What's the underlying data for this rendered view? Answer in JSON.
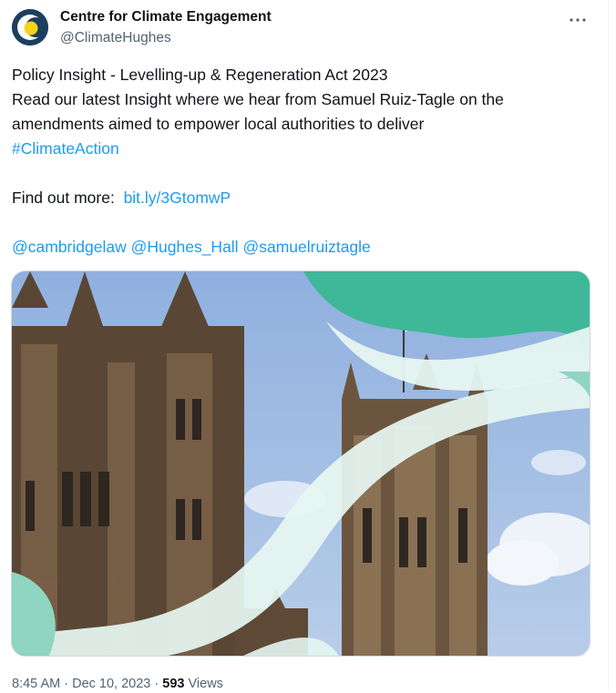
{
  "author": {
    "display_name": "Centre for Climate Engagement",
    "handle": "@ClimateHughes"
  },
  "tweet": {
    "line1": "Policy Insight - Levelling-up & Regeneration Act 2023",
    "line2": "Read our latest Insight where we hear from Samuel Ruiz-Tagle on the",
    "line3": "amendments aimed to empower local authorities to deliver",
    "hashtag": "#ClimateAction",
    "find_out_label": "Find out more:",
    "find_out_link": "bit.ly/3GtomwP",
    "mentions": [
      "@cambridgelaw",
      "@Hughes_Hall",
      "@samuelruiztagle"
    ]
  },
  "meta": {
    "time": "8:45 AM",
    "separator": "·",
    "date": "Dec 10, 2023",
    "views_count": "593",
    "views_label": "Views"
  },
  "colors": {
    "link": "#1d9bf0",
    "avatar_bg": "#1d3f5e",
    "avatar_accent": "#f7d418",
    "overlay_teal": "#3fb899",
    "overlay_light": "#e6f6f1"
  },
  "icons": {
    "more": "more-horizontal-icon",
    "avatar": "cce-logo-avatar"
  }
}
